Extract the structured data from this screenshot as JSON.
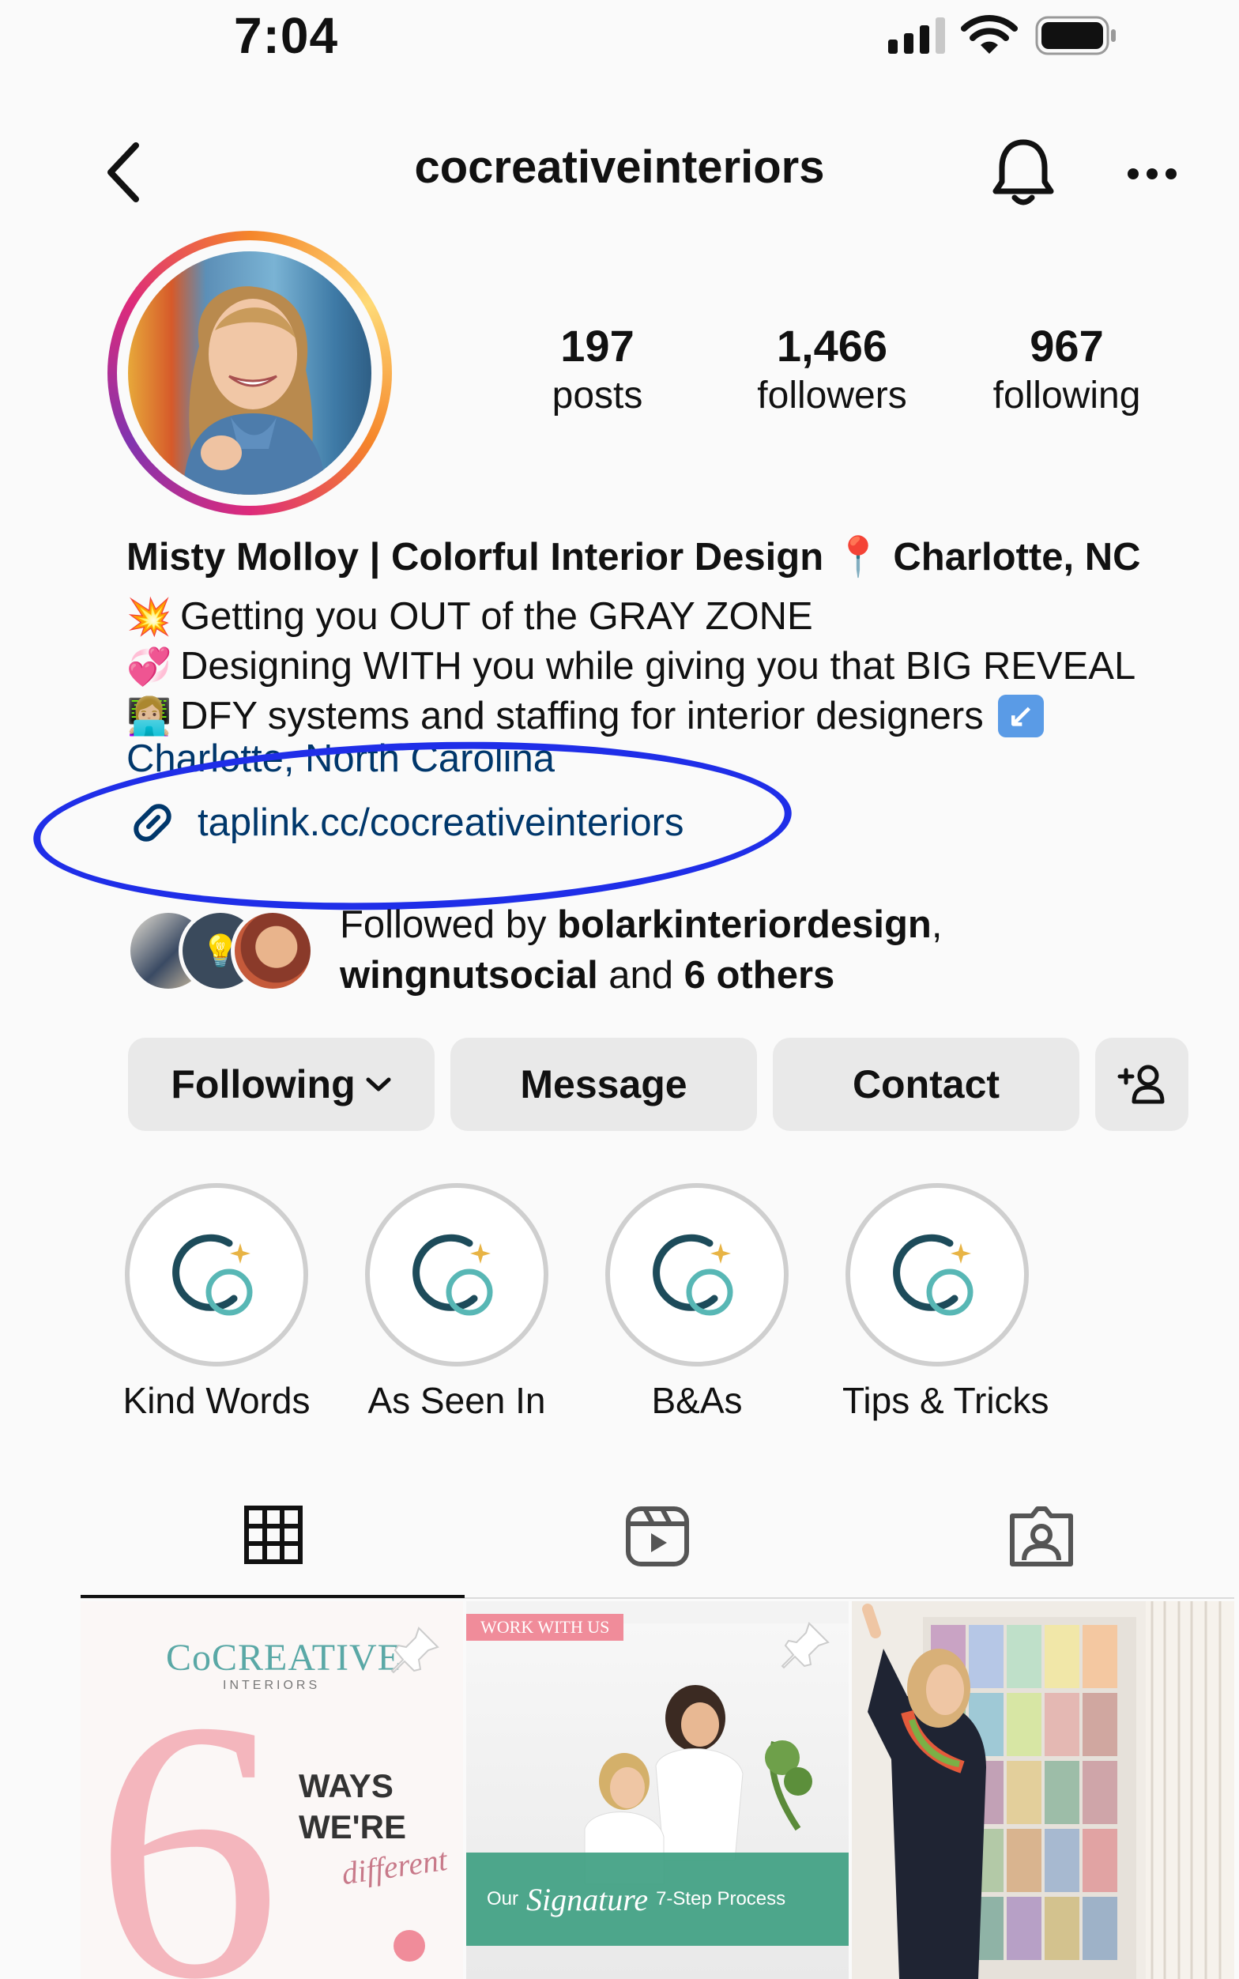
{
  "status_bar": {
    "time": "7:04"
  },
  "header": {
    "username": "cocreativeinteriors"
  },
  "stats": [
    {
      "count": "197",
      "label": "posts"
    },
    {
      "count": "1,466",
      "label": "followers"
    },
    {
      "count": "967",
      "label": "following"
    }
  ],
  "bio": {
    "name_line": "Misty Molloy | Colorful Interior Design",
    "location_tag": "Charlotte, NC",
    "lines": [
      {
        "emoji": "💥",
        "text": "Getting you OUT of the GRAY ZONE"
      },
      {
        "emoji": "💞",
        "text": "Designing WITH you while giving you that BIG REVEAL"
      },
      {
        "emoji": "👩🏼‍💻",
        "text": "DFY systems and staffing for interior designers"
      }
    ],
    "location": "Charlotte, North Carolina",
    "link": "taplink.cc/cocreativeinteriors"
  },
  "followed_by": {
    "prefix": "Followed by ",
    "user1": "bolarkinteriordesign",
    "sep": ",",
    "user2": "wingnutsocial",
    "middle": " and ",
    "others": "6 others"
  },
  "actions": {
    "following": "Following",
    "message": "Message",
    "contact": "Contact"
  },
  "highlights": [
    {
      "label": "Kind Words"
    },
    {
      "label": "As Seen In"
    },
    {
      "label": "B&As"
    },
    {
      "label": "Tips & Tricks"
    }
  ],
  "posts": {
    "post1": {
      "brand": "CoCREATIVE",
      "brand_sub": "INTERIORS",
      "number": "6",
      "line1": "WAYS",
      "line2": "WE'RE",
      "script": "different"
    },
    "post2": {
      "tag": "WORK WITH US",
      "caption_pre": "Our",
      "caption_script": "Signature",
      "caption_post": "7-Step Process"
    }
  },
  "colors": {
    "link": "#00376b",
    "annotation": "#1f2ee8",
    "button_bg": "#e9e9e9"
  }
}
